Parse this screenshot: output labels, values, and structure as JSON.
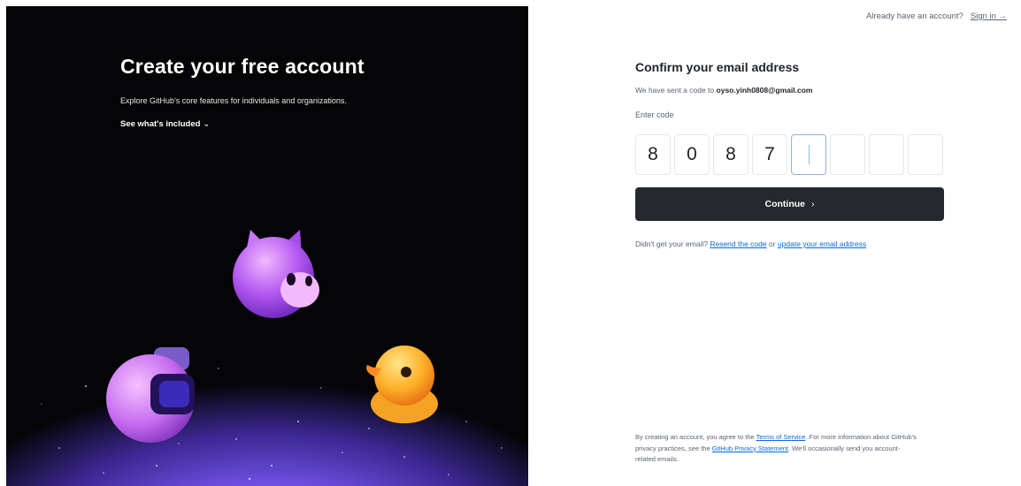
{
  "hero": {
    "title": "Create your free account",
    "subtitle": "Explore GitHub's core features for individuals and organizations.",
    "see_included": "See what's included",
    "chevron_glyph": "⌄"
  },
  "topbar": {
    "prompt": "Already have an account?",
    "sign_in": "Sign in →"
  },
  "form": {
    "title": "Confirm your email address",
    "sent_prefix": "We have sent a code to",
    "email": "oyso.yinh0808@gmail.com",
    "code_label": "Enter code",
    "digits": [
      "8",
      "0",
      "8",
      "7",
      "",
      "",
      "",
      ""
    ],
    "continue_label": "Continue",
    "continue_arrow": "›",
    "help": {
      "prefix": "Didn't get your email?",
      "resend": "Resend the code",
      "or": "or",
      "update": "update your email address"
    },
    "legal": {
      "part1": "By creating an account, you agree to the",
      "terms": "Terms of Service",
      "part2": ". For more information about GitHub's privacy practices, see the",
      "privacy": "GitHub Privacy Statement",
      "part3": ". We'll occasionally send you account-related emails."
    }
  },
  "colors": {
    "button_bg": "#25292e",
    "link": "#0969da",
    "hero_bg": "#050407",
    "hero_glow": "#a487ff"
  }
}
